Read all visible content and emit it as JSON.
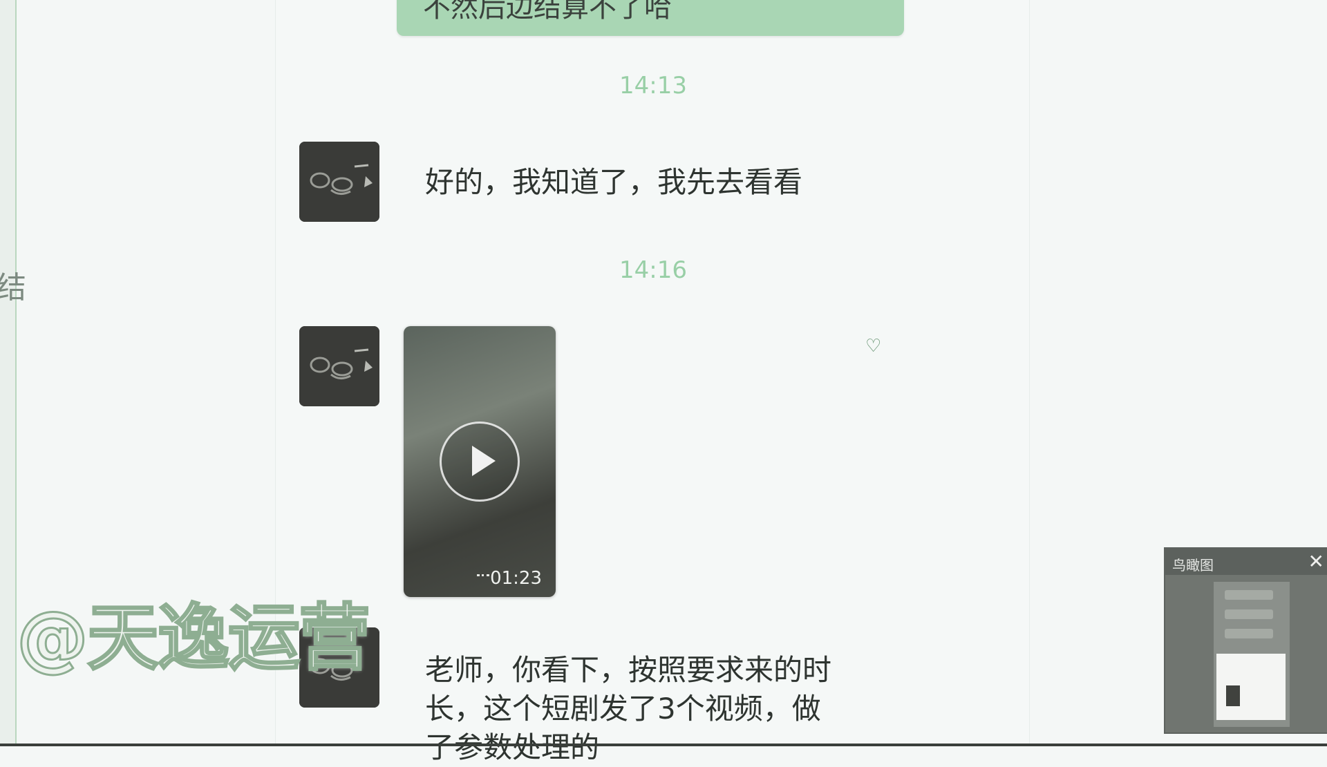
{
  "chat": {
    "top_bubble_text": "不然后边结算不了哈",
    "timestamps": [
      "14:13",
      "14:16"
    ],
    "messages": [
      {
        "text": "好的，我知道了，我先去看看"
      },
      {
        "video_duration": "01:23"
      },
      {
        "text_line1": "老师，你看下，按照要求来的时",
        "text_line2": "长，这个短剧发了3个视频，做",
        "text_line3": "了参数处理的"
      }
    ]
  },
  "watermark": "@天逸运营",
  "mini_window": {
    "title": "鸟瞰图",
    "close_label": "✕"
  },
  "left_panel_fragment": "结",
  "icons": {
    "avatar": "avatar-icon",
    "play": "play-icon",
    "small": "loading-icon"
  }
}
